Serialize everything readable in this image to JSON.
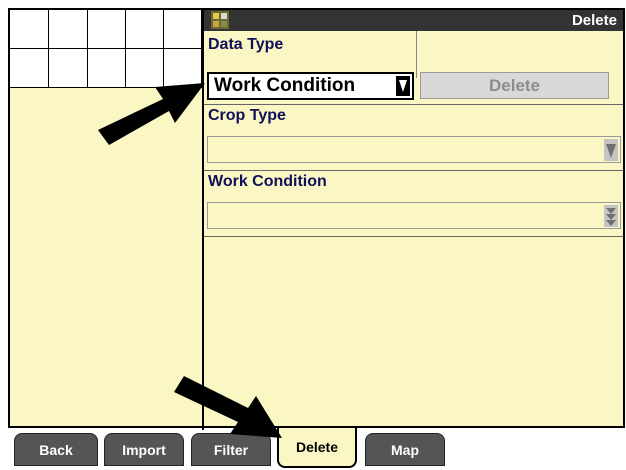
{
  "window": {
    "title": "Delete"
  },
  "grid": {
    "cols": 5,
    "rows": 2
  },
  "data_type": {
    "label": "Data Type",
    "value": "Work Condition"
  },
  "delete_button": {
    "label": "Delete"
  },
  "crop_type": {
    "label": "Crop Type",
    "value": ""
  },
  "work_condition": {
    "label": "Work Condition",
    "value": ""
  },
  "tabs": [
    {
      "label": "Back"
    },
    {
      "label": "Import"
    },
    {
      "label": "Filter"
    },
    {
      "label": "Delete",
      "active": true
    },
    {
      "label": "Map"
    }
  ],
  "colors": {
    "background": "#fbf7c4",
    "titlebar": "#333333",
    "tab": "#555555",
    "label": "#10105a"
  }
}
